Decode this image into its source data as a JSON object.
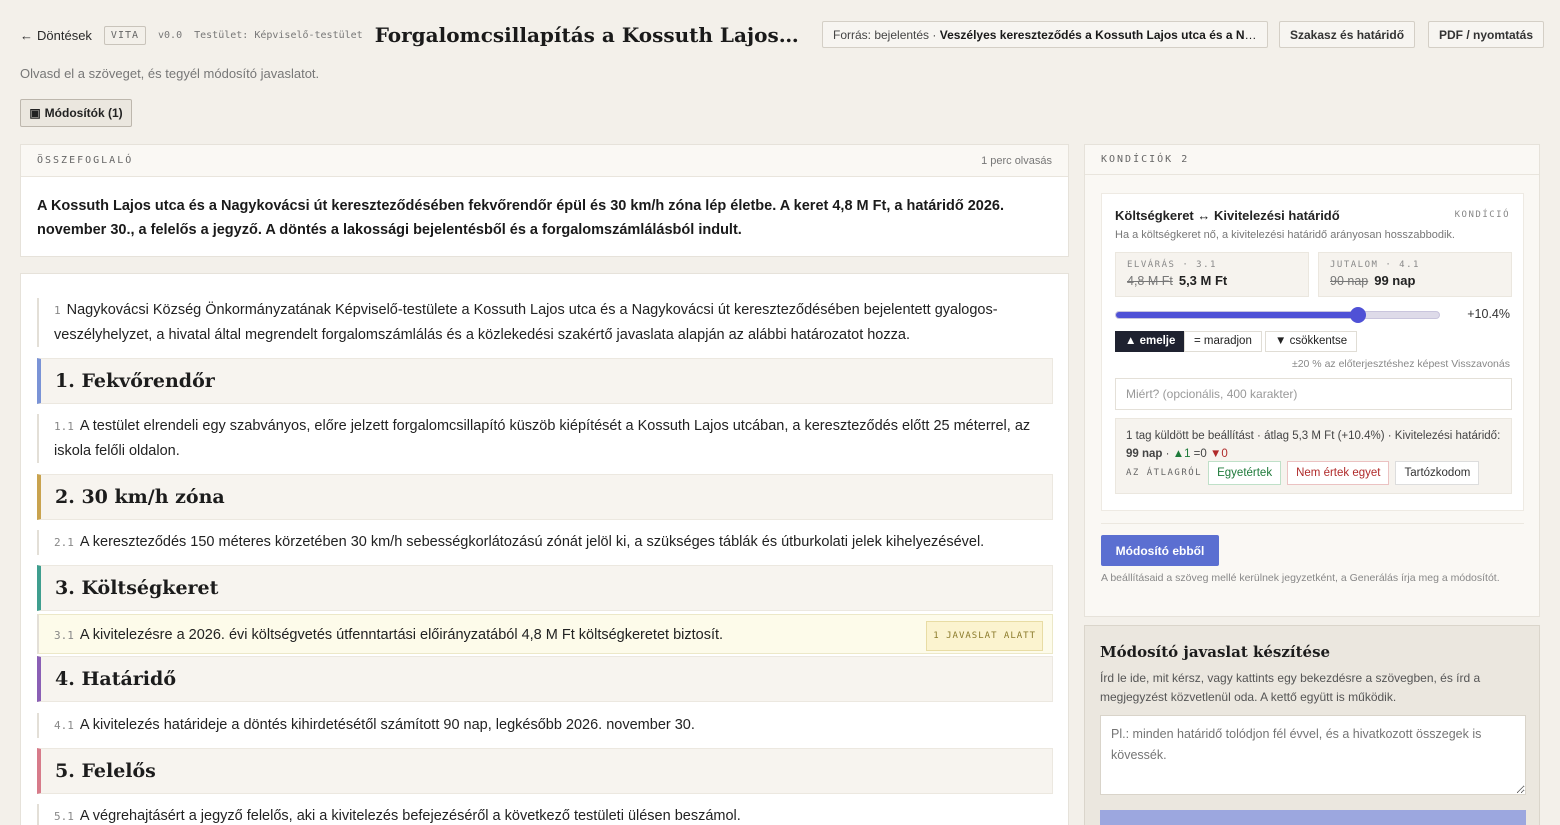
{
  "topbar": {
    "back_label": "Döntések",
    "status_badge": "VITA",
    "version": "v0.0",
    "body_label": "Testület: Képviselő-testület",
    "title": "Forgalomcsillapítás a Kossuth Lajos utca és a Nagykovácsi út kereszteződésében",
    "source_prefix": "Forrás: bejelentés ·",
    "source_value": "Veszélyes kereszteződés a Kossuth Lajos utca és a Nagykovácsi út sarkán",
    "section_button": "Szakasz és határidő",
    "pdf_button": "PDF / nyomtatás"
  },
  "subtitle": "Olvasd el a szöveget, és tegyél módosító javaslatot.",
  "modifiers_button": "Módosítók (1)",
  "summary": {
    "label": "ÖSSZEFOGLALÓ",
    "read_time": "1 perc olvasás",
    "text": "A Kossuth Lajos utca és a Nagykovácsi út kereszteződésében fekvőrendőr épül és 30 km/h zóna lép életbe. A keret 4,8 M Ft, a határidő 2026. november 30., a felelős a jegyző. A döntés a lakossági bejelentésből és a forgalomszámlálásból indult."
  },
  "document": {
    "p1_num": "1",
    "p1_text": "Nagykovácsi Község Önkormányzatának Képviselő-testülete a Kossuth Lajos utca és a Nagykovácsi út kereszteződésében bejelentett gyalogos-veszélyhelyzet, a hivatal által megrendelt forgalomszámlálás és a közlekedési szakértő javaslata alapján az alábbi határozatot hozza.",
    "s1_title": "1. Fekvőrendőr",
    "s1_color": "#7a93d6",
    "p11_num": "1.1",
    "p11_text": "A testület elrendeli egy szabványos, előre jelzett forgalomcsillapító küszöb kiépítését a Kossuth Lajos utcában, a kereszteződés előtt 25 méterrel, az iskola felőli oldalon.",
    "s2_title": "2. 30 km/h zóna",
    "s2_color": "#c9a34f",
    "p21_num": "2.1",
    "p21_text": "A kereszteződés 150 méteres körzetében 30 km/h sebességkorlátozású zónát jelöl ki, a szükséges táblák és útburkolati jelek kihelyezésével.",
    "s3_title": "3. Költségkeret",
    "s3_color": "#3f9e8f",
    "p31_num": "3.1",
    "p31_text": "A kivitelezésre a 2026. évi költségvetés útfenntartási előirányzatából 4,8 M Ft költségkeretet biztosít.",
    "p31_badge": "1 JAVASLAT ALATT",
    "s4_title": "4. Határidő",
    "s4_color": "#8a5fb5",
    "p41_num": "4.1",
    "p41_text": "A kivitelezés határideje a döntés kihirdetésétől számított 90 nap, legkésőbb 2026. november 30.",
    "s5_title": "5. Felelős",
    "s5_color": "#d77b8a",
    "p51_num": "5.1",
    "p51_text": "A végrehajtásért a jegyző felelős, aki a kivitelezés befejezéséről a következő testületi ülésen beszámol."
  },
  "conditions": {
    "label": "KONDÍCIÓK 2",
    "card_title": "Költségkeret ↔ Kivitelezési határidő",
    "card_tag": "KONDÍCIÓ",
    "card_desc": "Ha a költségkeret nő, a kivitelezési határidő arányosan hosszabbodik.",
    "ask_label": "ELVÁRÁS · 3.1",
    "ask_old": "4,8 M Ft",
    "ask_new": "5,3 M Ft",
    "reward_label": "JUTALOM · 4.1",
    "reward_old": "90 nap",
    "reward_new": "99 nap",
    "slider_level": 0.75,
    "slider_pct": "+10.4%",
    "btn_raise": "▲ emelje",
    "btn_keep": "= maradjon",
    "btn_lower": "▼ csökkentse",
    "hint_text": "±20 % az előterjesztéshez képest",
    "undo_label": "Visszavonás",
    "why_placeholder": "Miért? (opcionális, 400 karakter)",
    "stats_text": "1 tag küldött be beállítást · átlag 5,3 M Ft (+10.4%) · Kivitelezési határidő:",
    "stats_value": "99 nap",
    "stats_sep": "·",
    "stat_up": "▲1",
    "stat_eq": "=0",
    "stat_down": "▼0",
    "avg_label": "AZ ÁTLAGRÓL",
    "avg_agree": "Egyetértek",
    "avg_disagree": "Nem értek egyet",
    "avg_abstain": "Tartózkodom",
    "from_button": "Módosító ebből",
    "from_note": "A beállításaid a szöveg mellé kerülnek jegyzetként, a Generálás írja meg a módosítót."
  },
  "create": {
    "title": "Módosító javaslat készítése",
    "desc": "Írd le ide, mit kérsz, vagy kattints egy bekezdésre a szövegben, és írd a megjegyzést közvetlenül oda. A kettő együtt is működik.",
    "placeholder": "Pl.: minden határidő tolódjon fél évvel, és a hivatkozott összegek is kövessék."
  }
}
